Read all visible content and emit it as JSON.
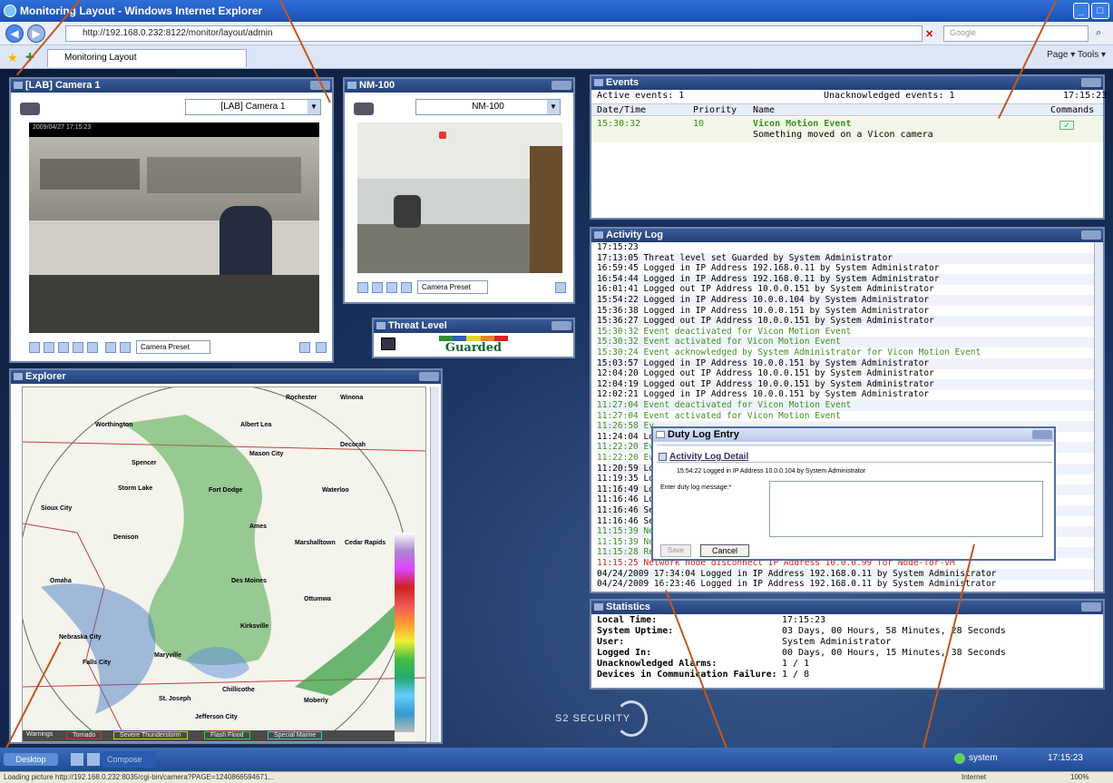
{
  "browser": {
    "title": "Monitoring Layout - Windows Internet Explorer",
    "url": "http://192.168.0.232:8122/monitor/layout/admin",
    "search_placeholder": "Google",
    "tab_label": "Monitoring Layout",
    "commands": "Page ▾  Tools ▾"
  },
  "camera1": {
    "title": "[LAB] Camera 1",
    "select_value": "[LAB] Camera 1",
    "timestamp": "2009/04/27 17:15:23",
    "preset": "Camera Preset"
  },
  "camera2": {
    "title": "NM-100",
    "select_value": "NM-100",
    "preset": "Camera Preset"
  },
  "threat": {
    "title": "Threat Level",
    "level": "Guarded"
  },
  "explorer": {
    "title": "Explorer",
    "cities": [
      "Rochester",
      "Winona",
      "Worthington",
      "Albert Lea",
      "Mason City",
      "Decorah",
      "Spencer",
      "Storm Lake",
      "Fort Dodge",
      "Waterloo",
      "Sioux City",
      "Denison",
      "Ames",
      "Cedar Rapids",
      "Marshalltown",
      "Omaha",
      "Des Moines",
      "Ottumwa",
      "Nebraska City",
      "Falls City",
      "Maryville",
      "St. Joseph",
      "Kirksville",
      "Chillicothe",
      "Moberly",
      "Jefferson City"
    ],
    "legend_buttons": [
      "Warnings",
      "Tornado",
      "Severe Thunderstorm",
      "Flash Flood",
      "Special Marine"
    ]
  },
  "events": {
    "title": "Events",
    "active": "Active events: 1",
    "unack": "Unacknowledged events: 1",
    "time": "17:15:23",
    "headers": [
      "Date/Time",
      "Priority",
      "Name",
      "Commands"
    ],
    "row": {
      "time": "15:30:32",
      "priority": "10",
      "name": "Vicon Motion Event",
      "desc": "Something moved on a Vicon camera"
    }
  },
  "activity": {
    "title": "Activity Log",
    "lines": [
      {
        "t": "17:15:23",
        "c": ""
      },
      {
        "t": "17:13:05 Threat level set Guarded by System Administrator",
        "c": ""
      },
      {
        "t": "16:59:45 Logged in IP Address 192.168.0.11 by System Administrator",
        "c": ""
      },
      {
        "t": "16:54:44 Logged in IP Address 192.168.0.11 by System Administrator",
        "c": ""
      },
      {
        "t": "16:01:41 Logged out IP Address 10.0.0.151 by System Administrator",
        "c": ""
      },
      {
        "t": "15:54:22 Logged in IP Address 10.0.0.104 by System Administrator",
        "c": ""
      },
      {
        "t": "15:36:38 Logged in IP Address 10.0.0.151 by System Administrator",
        "c": ""
      },
      {
        "t": "15:36:27 Logged out IP Address 10.0.0.151 by System Administrator",
        "c": ""
      },
      {
        "t": "15:30:32 Event deactivated for Vicon Motion Event",
        "c": "green"
      },
      {
        "t": "15:30:32 Event activated for Vicon Motion Event",
        "c": "green"
      },
      {
        "t": "15:30:24 Event acknowledged by System Administrator for Vicon Motion Event",
        "c": "green"
      },
      {
        "t": "15:03:57 Logged in IP Address 10.0.0.151 by System Administrator",
        "c": ""
      },
      {
        "t": "12:04:20 Logged out IP Address 10.0.0.151 by System Administrator",
        "c": ""
      },
      {
        "t": "12:04:19 Logged out IP Address 10.0.0.151 by System Administrator",
        "c": ""
      },
      {
        "t": "12:02:21 Logged in IP Address 10.0.0.151 by System Administrator",
        "c": ""
      },
      {
        "t": "11:27:04 Event deactivated for Vicon Motion Event",
        "c": "green"
      },
      {
        "t": "11:27:04 Event activated for Vicon Motion Event",
        "c": "green"
      },
      {
        "t": "11:26:58 Ev",
        "c": "green"
      },
      {
        "t": "11:24:04 Lo",
        "c": ""
      },
      {
        "t": "11:22:20 Ev",
        "c": "green"
      },
      {
        "t": "11:22:20 Ev",
        "c": "green"
      },
      {
        "t": "11:20:59 Lo",
        "c": ""
      },
      {
        "t": "11:19:35 Lo",
        "c": ""
      },
      {
        "t": "11:16:49 Lo",
        "c": ""
      },
      {
        "t": "11:16:46 Lo",
        "c": ""
      },
      {
        "t": "11:16:46 Se",
        "c": ""
      },
      {
        "t": "11:16:46 Se",
        "c": ""
      },
      {
        "t": "11:15:39 Ne",
        "c": "green"
      },
      {
        "t": "11:15:39 Ne",
        "c": "green"
      },
      {
        "t": "11:15:28 Re",
        "c": "green"
      },
      {
        "t": "11:15:25 Network node disconnect IP Address 10.0.0.99 for Node-for-VM",
        "c": "red"
      },
      {
        "t": "04/24/2009 17:34:04 Logged in IP Address 192.168.0.11 by System Administrator",
        "c": ""
      },
      {
        "t": "04/24/2009 16:23:46 Logged in IP Address 192.168.0.11 by System Administrator",
        "c": ""
      }
    ]
  },
  "dutylog": {
    "title": "Duty Log Entry",
    "detail_title": "Activity Log Detail",
    "detail_line": "15:54:22 Logged in IP Address 10.0.0.104 by System Administrator",
    "prompt": "Enter duty log message:*",
    "save": "Save",
    "cancel": "Cancel"
  },
  "stats": {
    "title": "Statistics",
    "rows": [
      {
        "k": "Local Time:",
        "v": "17:15:23"
      },
      {
        "k": "System Uptime:",
        "v": "03 Days, 00 Hours, 58 Minutes, 28 Seconds"
      },
      {
        "k": "User:",
        "v": "System Administrator"
      },
      {
        "k": "Logged In:",
        "v": "00 Days, 00 Hours, 15 Minutes, 38 Seconds"
      },
      {
        "k": "Unacknowledged Alarms:",
        "v": "1 / 1"
      },
      {
        "k": "Devices in Communication Failure:",
        "v": "1 / 8"
      }
    ]
  },
  "brand": "S2 SECURITY",
  "taskbar": {
    "desktop": "Desktop",
    "compose": "Compose",
    "user": "system",
    "clock": "17:15:23"
  },
  "status": {
    "text": "Loading picture http://192.168.0.232:8035/cgi-bin/camera?PAGE=1240866594671...",
    "zone": "Internet",
    "zoom": "100%"
  },
  "colors": {
    "accent": "#233f75",
    "green": "#3d8f1f",
    "red": "#d42020",
    "callout": "#c2581e"
  }
}
